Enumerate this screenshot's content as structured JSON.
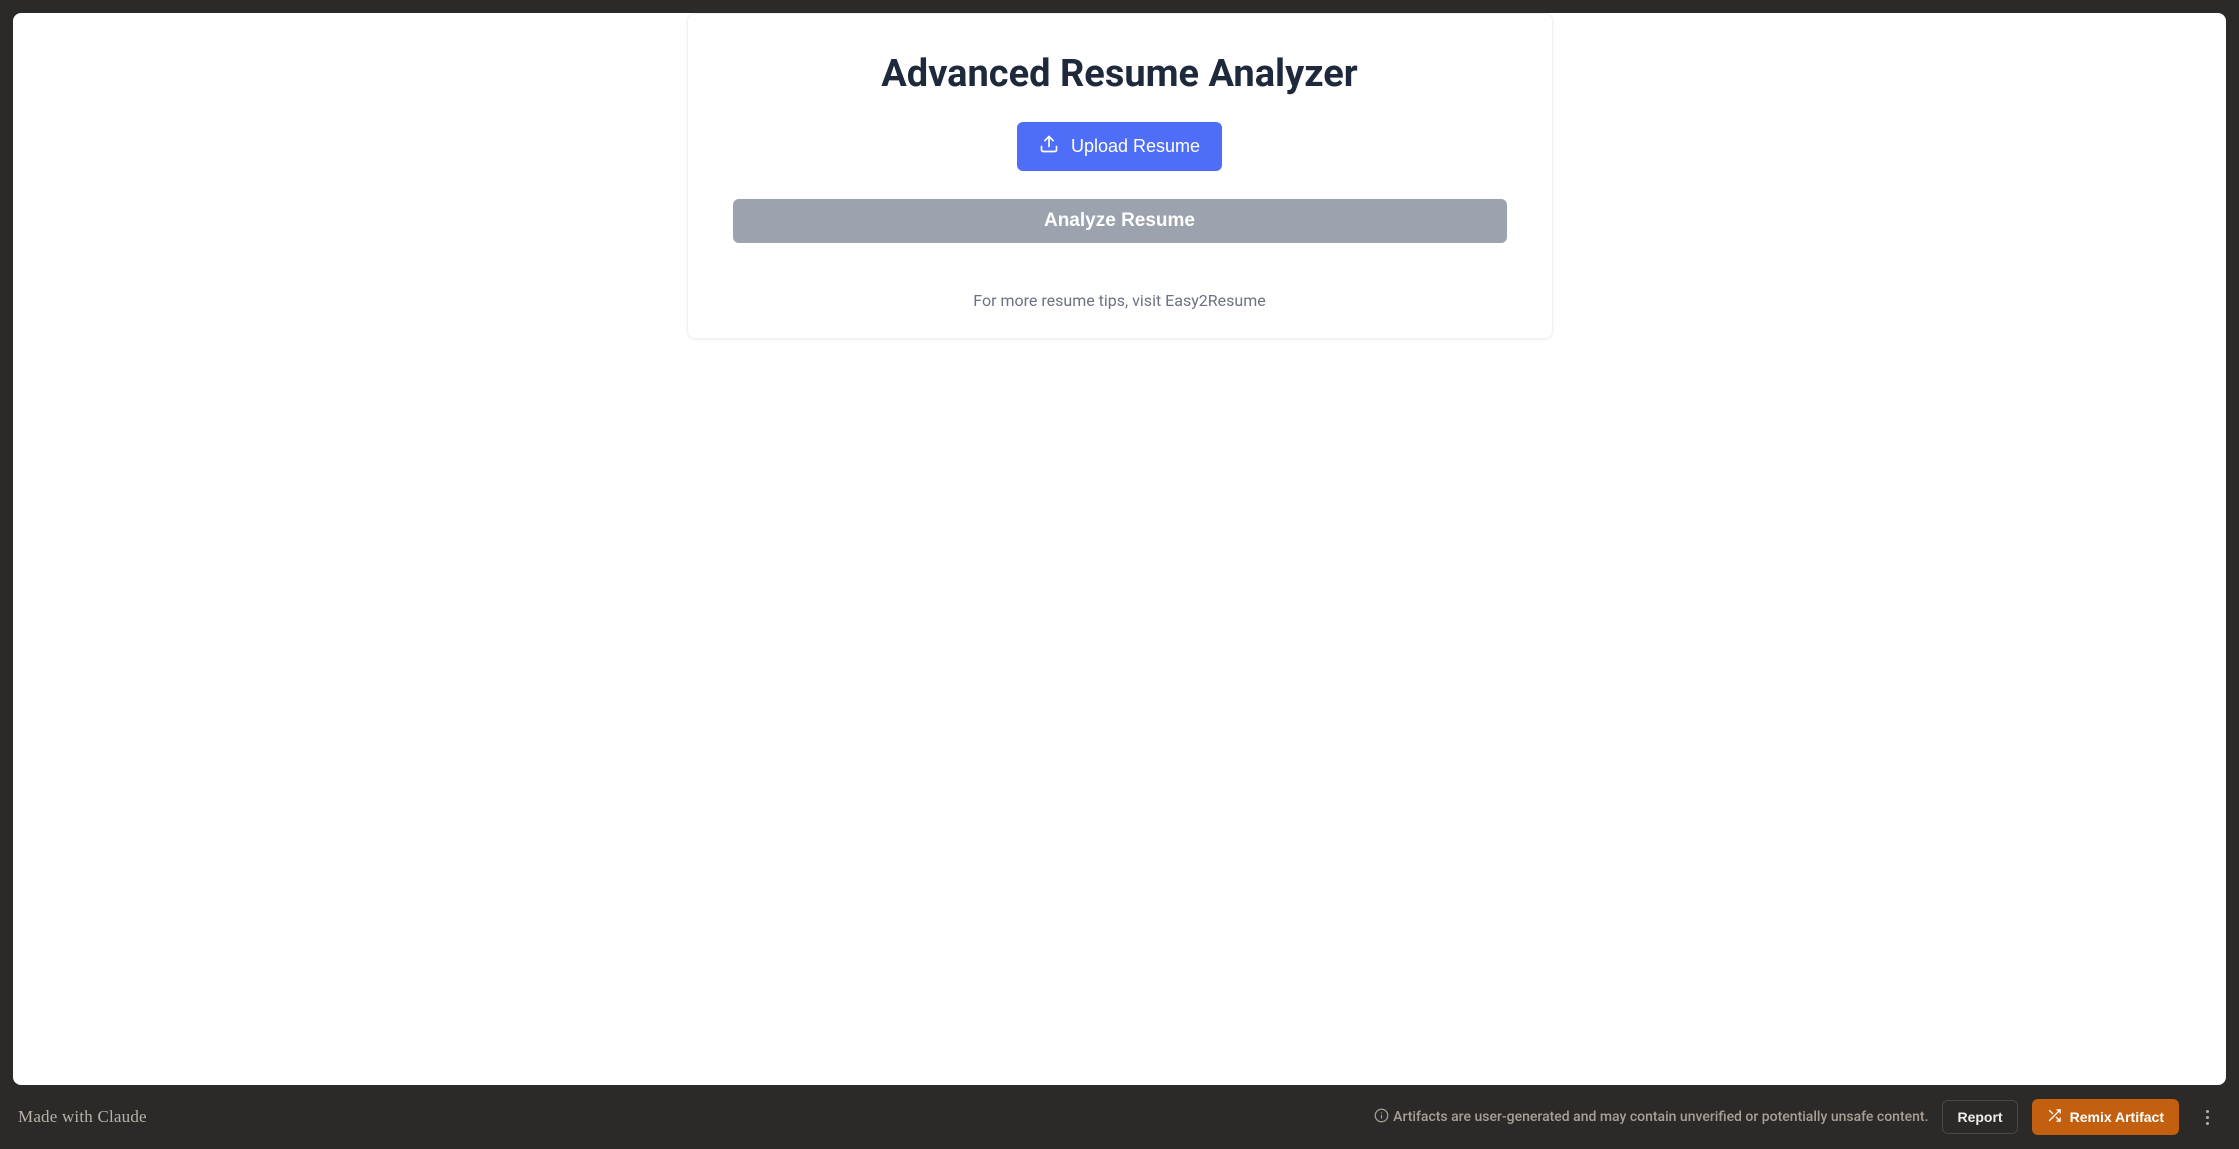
{
  "main": {
    "title": "Advanced Resume Analyzer",
    "upload_label": "Upload Resume",
    "analyze_label": "Analyze Resume",
    "tip_prefix": "For more resume tips, visit ",
    "tip_link_label": "Easy2Resume"
  },
  "footer": {
    "made_with_prefix": "Made with ",
    "made_with_brand": "Claude",
    "disclaimer": "Artifacts are user-generated and may contain unverified or potentially unsafe content.",
    "report_label": "Report",
    "remix_label": "Remix Artifact"
  },
  "colors": {
    "primary": "#4f6ef7",
    "disabled": "#9ca3af",
    "accent": "#c2600f",
    "frame": "#2b2a28"
  }
}
